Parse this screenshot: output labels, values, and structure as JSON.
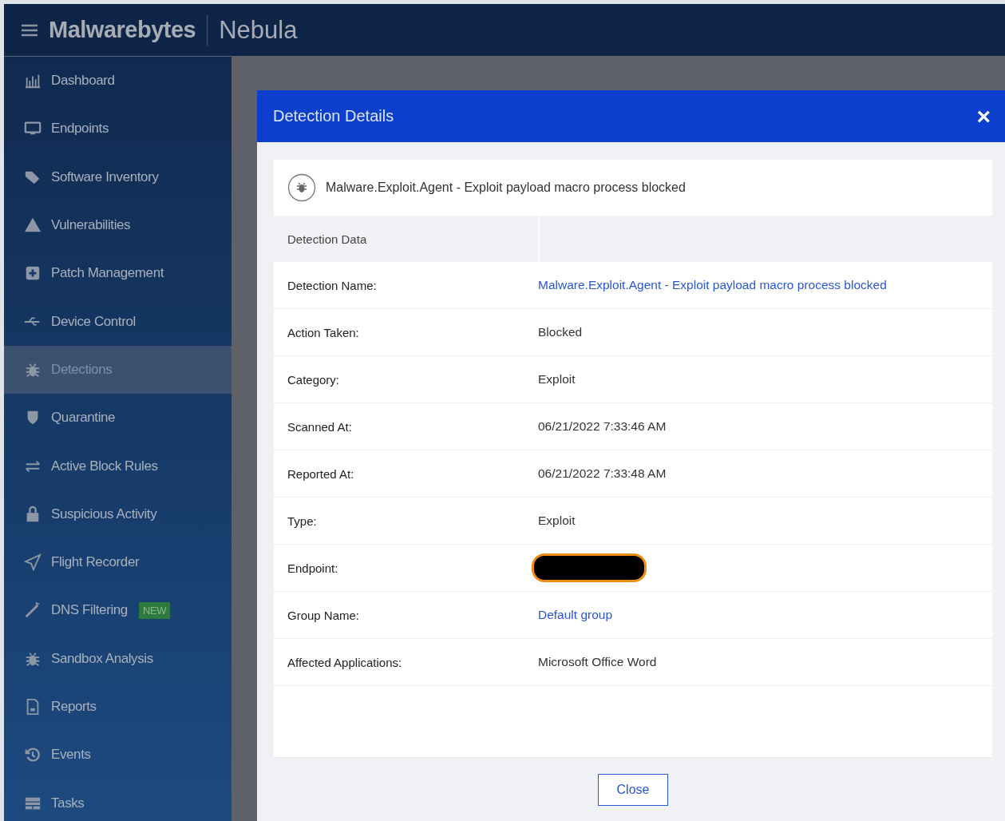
{
  "header": {
    "logo": "Malwarebytes",
    "product": "Nebula"
  },
  "sidebar": {
    "items": [
      {
        "label": "Dashboard",
        "selected": false
      },
      {
        "label": "Endpoints",
        "selected": false
      },
      {
        "label": "Software Inventory",
        "selected": false
      },
      {
        "label": "Vulnerabilities",
        "selected": false
      },
      {
        "label": "Patch Management",
        "selected": false
      },
      {
        "label": "Device Control",
        "selected": false
      },
      {
        "label": "Detections",
        "selected": true
      },
      {
        "label": "Quarantine",
        "selected": false
      },
      {
        "label": "Active Block Rules",
        "selected": false
      },
      {
        "label": "Suspicious Activity",
        "selected": false
      },
      {
        "label": "Flight Recorder",
        "selected": false
      },
      {
        "label": "DNS Filtering",
        "selected": false,
        "badge": "NEW"
      },
      {
        "label": "Sandbox Analysis",
        "selected": false
      },
      {
        "label": "Reports",
        "selected": false
      },
      {
        "label": "Events",
        "selected": false
      },
      {
        "label": "Tasks",
        "selected": false
      }
    ]
  },
  "dialog": {
    "title": "Detection Details",
    "close_icon": "×",
    "summary": "Malware.Exploit.Agent - Exploit payload macro process blocked",
    "section_heading": "Detection Data",
    "rows": [
      {
        "label": "Detection Name:",
        "kind": "link",
        "value": "Malware.Exploit.Agent - Exploit payload macro process blocked"
      },
      {
        "label": "Action Taken:",
        "kind": "text",
        "value": "Blocked"
      },
      {
        "label": "Category:",
        "kind": "text",
        "value": "Exploit"
      },
      {
        "label": "Scanned At:",
        "kind": "text",
        "value": "06/21/2022 7:33:46 AM"
      },
      {
        "label": "Reported At:",
        "kind": "text",
        "value": "06/21/2022 7:33:48 AM"
      },
      {
        "label": "Type:",
        "kind": "text",
        "value": "Exploit"
      },
      {
        "label": "Endpoint:",
        "kind": "redacted"
      },
      {
        "label": "Group Name:",
        "kind": "link",
        "value": "Default group"
      },
      {
        "label": "Affected Applications:",
        "kind": "text",
        "value": "Microsoft Office Word"
      }
    ],
    "button": "Close"
  }
}
